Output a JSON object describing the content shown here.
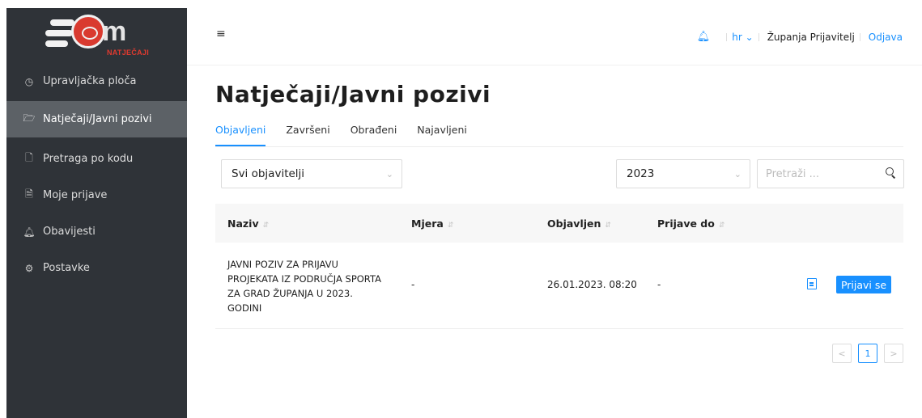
{
  "logo": {
    "subtitle": "NATJEČAJI"
  },
  "sidebar": {
    "items": [
      {
        "label": "Upravljačka ploča",
        "icon": "dashboard-icon",
        "glyph": "◷"
      },
      {
        "label": "Natječaji/Javni pozivi",
        "icon": "folder-open-icon",
        "glyph": "🗁"
      },
      {
        "label": "Pretraga po kodu",
        "icon": "file-icon",
        "glyph": "🗋"
      },
      {
        "label": "Moje prijave",
        "icon": "document-icon",
        "glyph": "🗎"
      },
      {
        "label": "Obavijesti",
        "icon": "bell-icon",
        "glyph": "♫"
      },
      {
        "label": "Postavke",
        "icon": "gear-icon",
        "glyph": "⚙"
      }
    ],
    "active_index": 1
  },
  "header": {
    "language": "hr",
    "user": "Županja Prijavitelj",
    "logout": "Odjava"
  },
  "main": {
    "title": "Natječaji/Javni pozivi",
    "tabs": [
      "Objavljeni",
      "Završeni",
      "Obrađeni",
      "Najavljeni"
    ],
    "active_tab": 0,
    "filters": {
      "publisher": "Svi objavitelji",
      "year": "2023",
      "search_placeholder": "Pretraži ..."
    },
    "table": {
      "columns": [
        "Naziv",
        "Mjera",
        "Objavljen",
        "Prijave do"
      ],
      "rows": [
        {
          "naziv": "JAVNI POZIV ZA PRIJAVU PROJEKATA IZ PODRUČJA SPORTA ZA GRAD ŽUPANJA U 2023. GODINI",
          "mjera": "-",
          "objavljen": "26.01.2023. 08:20",
          "prijave_do": "-",
          "action": "Prijavi se"
        }
      ]
    },
    "pagination": {
      "current": "1",
      "prev": "<",
      "next": ">"
    }
  },
  "colors": {
    "accent": "#1890ff",
    "sidebar": "#2f3338",
    "sidebar_active": "#5c6166",
    "brand_red": "#d93a2f"
  }
}
